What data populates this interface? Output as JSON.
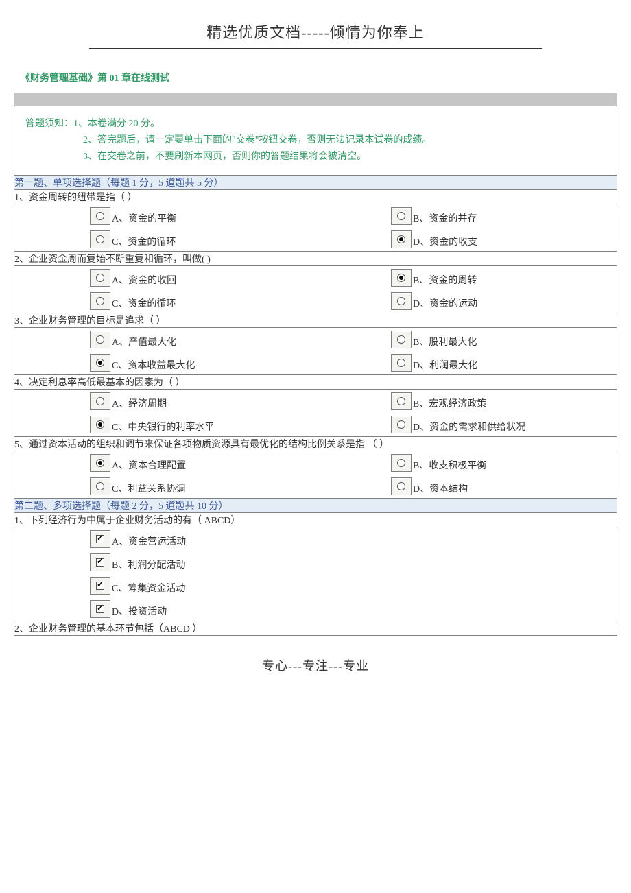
{
  "header": "精选优质文档-----倾情为你奉上",
  "test_title": "《财务管理基础》第 01 章在线测试",
  "instructions": {
    "line1": "答题须知：1、本卷满分 20 分。",
    "line2": "2、答完题后，请一定要单击下面的\"交卷\"按钮交卷，否则无法记录本试卷的成绩。",
    "line3": "3、在交卷之前，不要刷新本网页，否则你的答题结果将会被清空。"
  },
  "section1": {
    "header": "第一题、单项选择题（每题 1 分，5 道题共 5 分）",
    "questions": [
      {
        "text": "1、资金周转的纽带是指（ ）",
        "options": [
          {
            "label": "A、资金的平衡",
            "checked": false
          },
          {
            "label": "B、资金的并存",
            "checked": false
          },
          {
            "label": "C、资金的循环",
            "checked": false
          },
          {
            "label": "D、资金的收支",
            "checked": true
          }
        ]
      },
      {
        "text": "2、企业资金周而复始不断重复和循环，叫做( )",
        "options": [
          {
            "label": "A、资金的收回",
            "checked": false
          },
          {
            "label": "B、资金的周转",
            "checked": true
          },
          {
            "label": "C、资金的循环",
            "checked": false
          },
          {
            "label": "D、资金的运动",
            "checked": false
          }
        ]
      },
      {
        "text": "3、企业财务管理的目标是追求（ ）",
        "options": [
          {
            "label": "A、产值最大化",
            "checked": false
          },
          {
            "label": "B、股利最大化",
            "checked": false
          },
          {
            "label": "C、资本收益最大化",
            "checked": true
          },
          {
            "label": "D、利润最大化",
            "checked": false
          }
        ]
      },
      {
        "text": "4、决定利息率高低最基本的因素为（ ）",
        "options": [
          {
            "label": "A、经济周期",
            "checked": false
          },
          {
            "label": "B、宏观经济政策",
            "checked": false
          },
          {
            "label": "C、中央银行的利率水平",
            "checked": true
          },
          {
            "label": "D、资金的需求和供给状况",
            "checked": false
          }
        ]
      },
      {
        "text": "5、通过资本活动的组织和调节来保证各项物质资源具有最优化的结构比例关系是指 （ ）",
        "options": [
          {
            "label": "A、资本合理配置",
            "checked": true
          },
          {
            "label": "B、收支积极平衡",
            "checked": false
          },
          {
            "label": "C、利益关系协调",
            "checked": false
          },
          {
            "label": "D、资本结构",
            "checked": false
          }
        ]
      }
    ]
  },
  "section2": {
    "header": "第二题、多项选择题（每题 2 分，5 道题共 10 分）",
    "questions": [
      {
        "text": "1、下列经济行为中属于企业财务活动的有（ ABCD）",
        "options": [
          {
            "label": "A、资金营运活动",
            "checked": true
          },
          {
            "label": "B、利润分配活动",
            "checked": true
          },
          {
            "label": "C、筹集资金活动",
            "checked": true
          },
          {
            "label": "D、投资活动",
            "checked": true
          }
        ]
      },
      {
        "text": "2、企业财务管理的基本环节包括（ABCD ）",
        "options": []
      }
    ]
  },
  "footer": "专心---专注---专业"
}
